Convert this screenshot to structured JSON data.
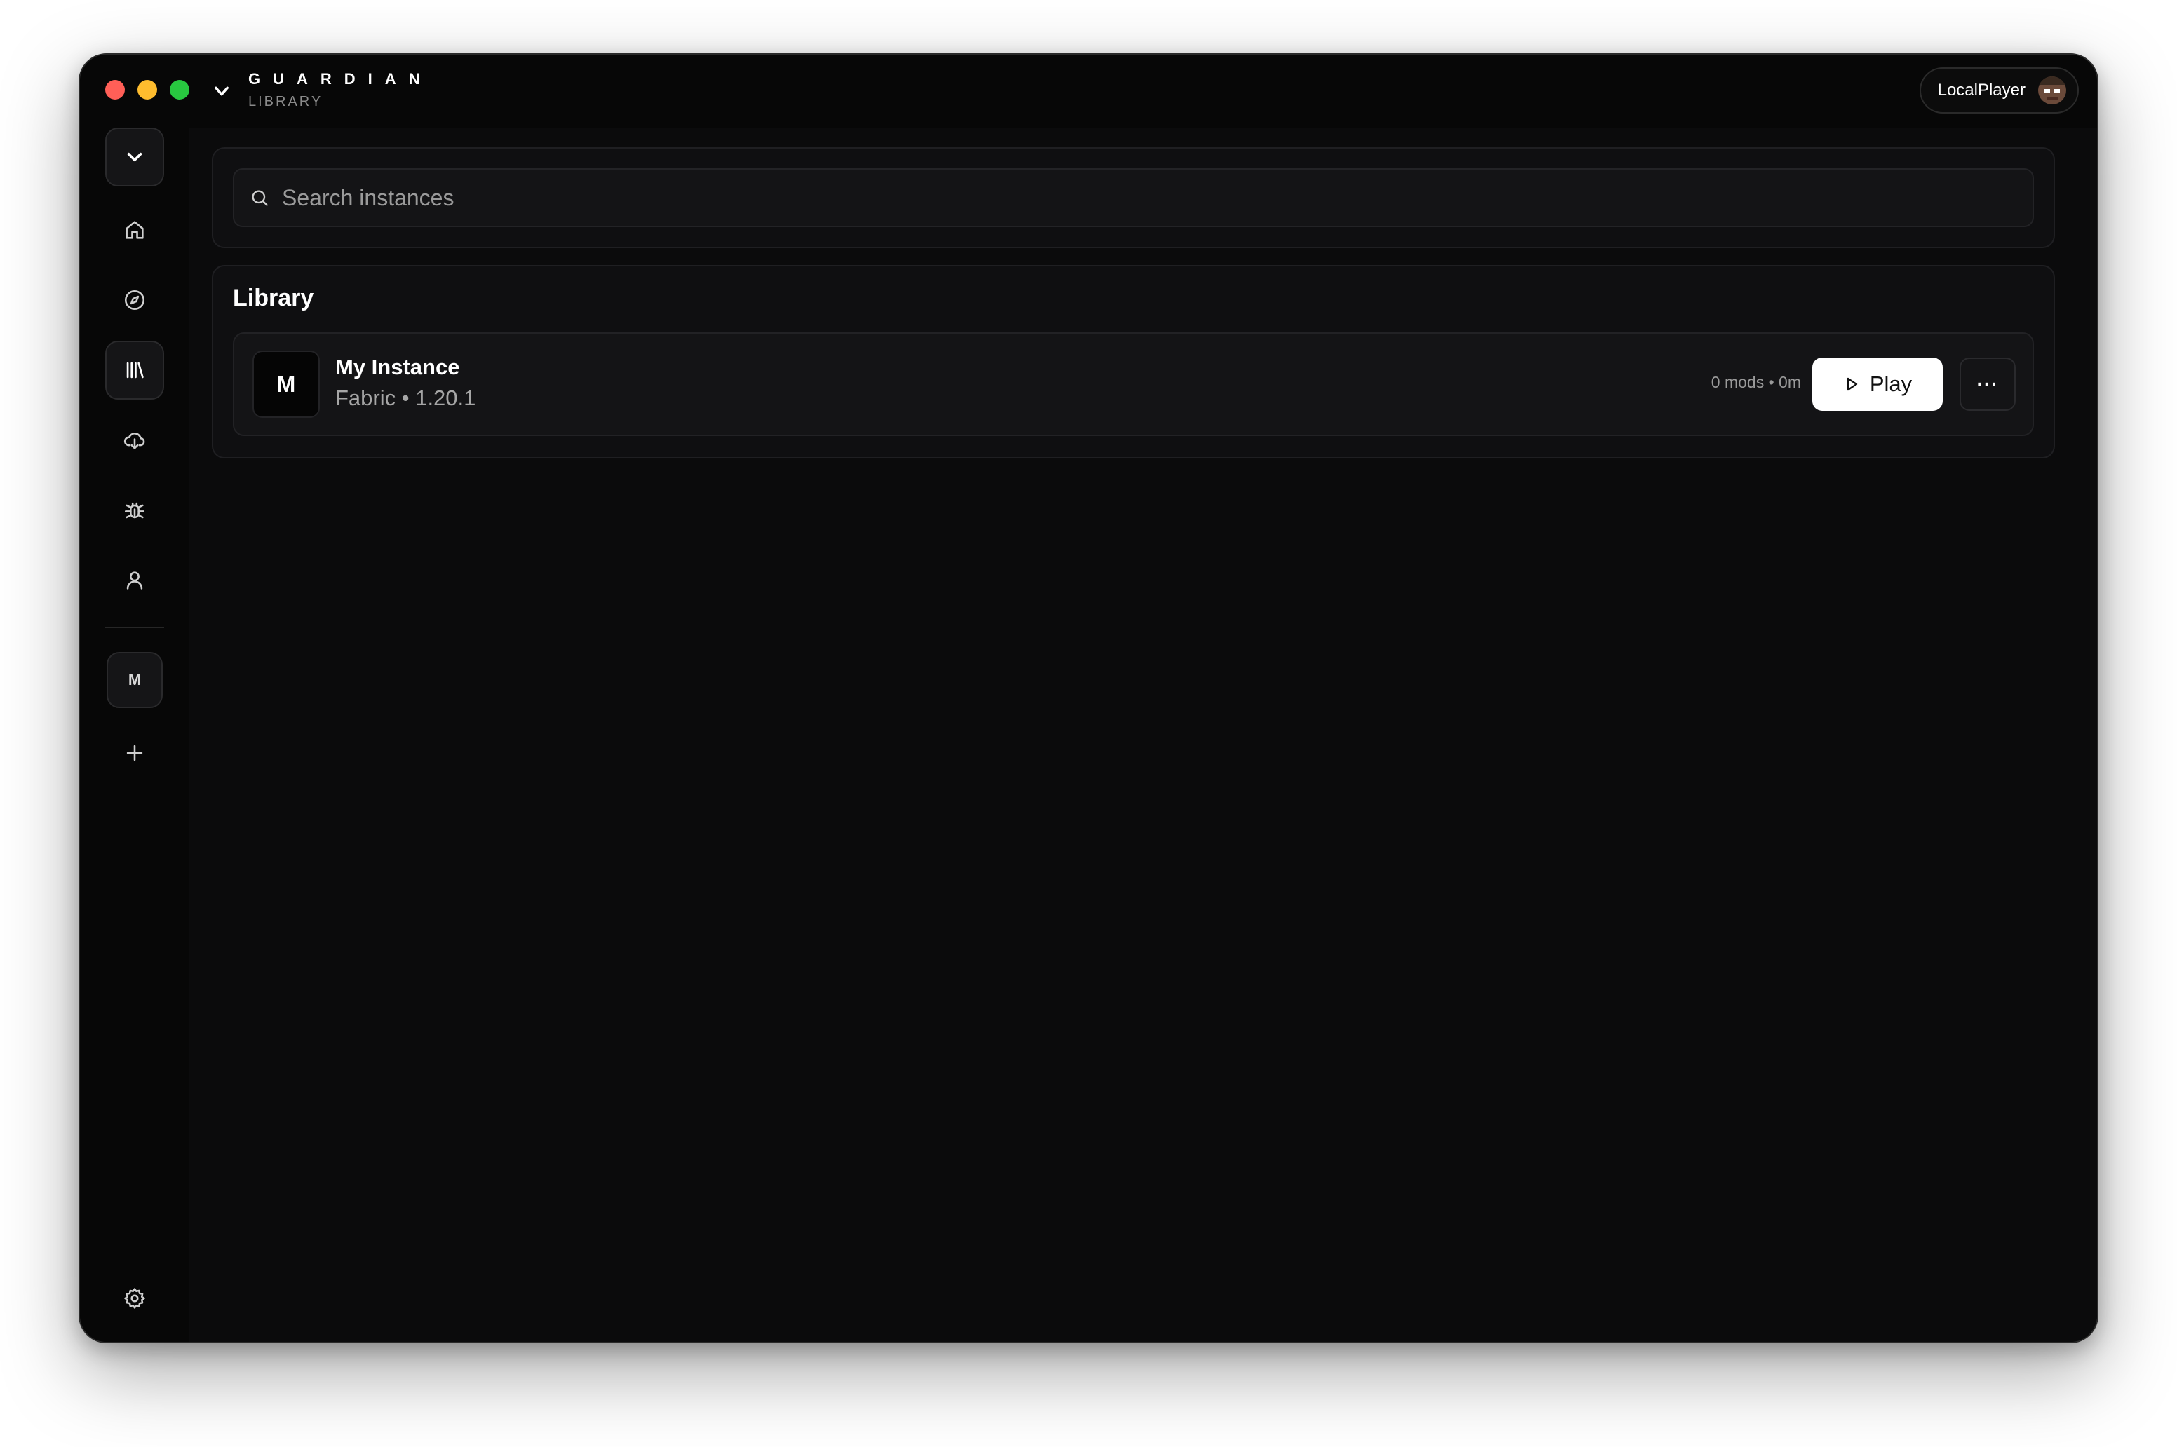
{
  "window": {
    "brand_name": "GUARDIAN",
    "brand_section": "LIBRARY"
  },
  "user": {
    "name": "LocalPlayer"
  },
  "sidebar": {
    "items": [
      {
        "icon": "chevron-down-icon",
        "label": "menu"
      },
      {
        "icon": "home-icon",
        "label": "home"
      },
      {
        "icon": "compass-icon",
        "label": "discover"
      },
      {
        "icon": "library-icon",
        "label": "library",
        "active": true
      },
      {
        "icon": "cloud-download-icon",
        "label": "downloads"
      },
      {
        "icon": "bug-icon",
        "label": "debug"
      },
      {
        "icon": "user-icon",
        "label": "account"
      }
    ],
    "instance_shortcut": "M",
    "add_icon": "plus-icon",
    "settings_icon": "gear-icon"
  },
  "search": {
    "placeholder": "Search instances",
    "value": ""
  },
  "library": {
    "title": "Library",
    "instances": [
      {
        "icon_letter": "M",
        "name": "My Instance",
        "meta": "Fabric • 1.20.1",
        "stats": "0 mods • 0m",
        "play_label": "Play",
        "more_label": "···"
      }
    ]
  },
  "colors": {
    "background": "#0b0b0c",
    "panel": "#0f0f11",
    "accent": "#ffffff",
    "traffic_red": "#ff5f57",
    "traffic_yellow": "#febc2e",
    "traffic_green": "#28c840"
  }
}
